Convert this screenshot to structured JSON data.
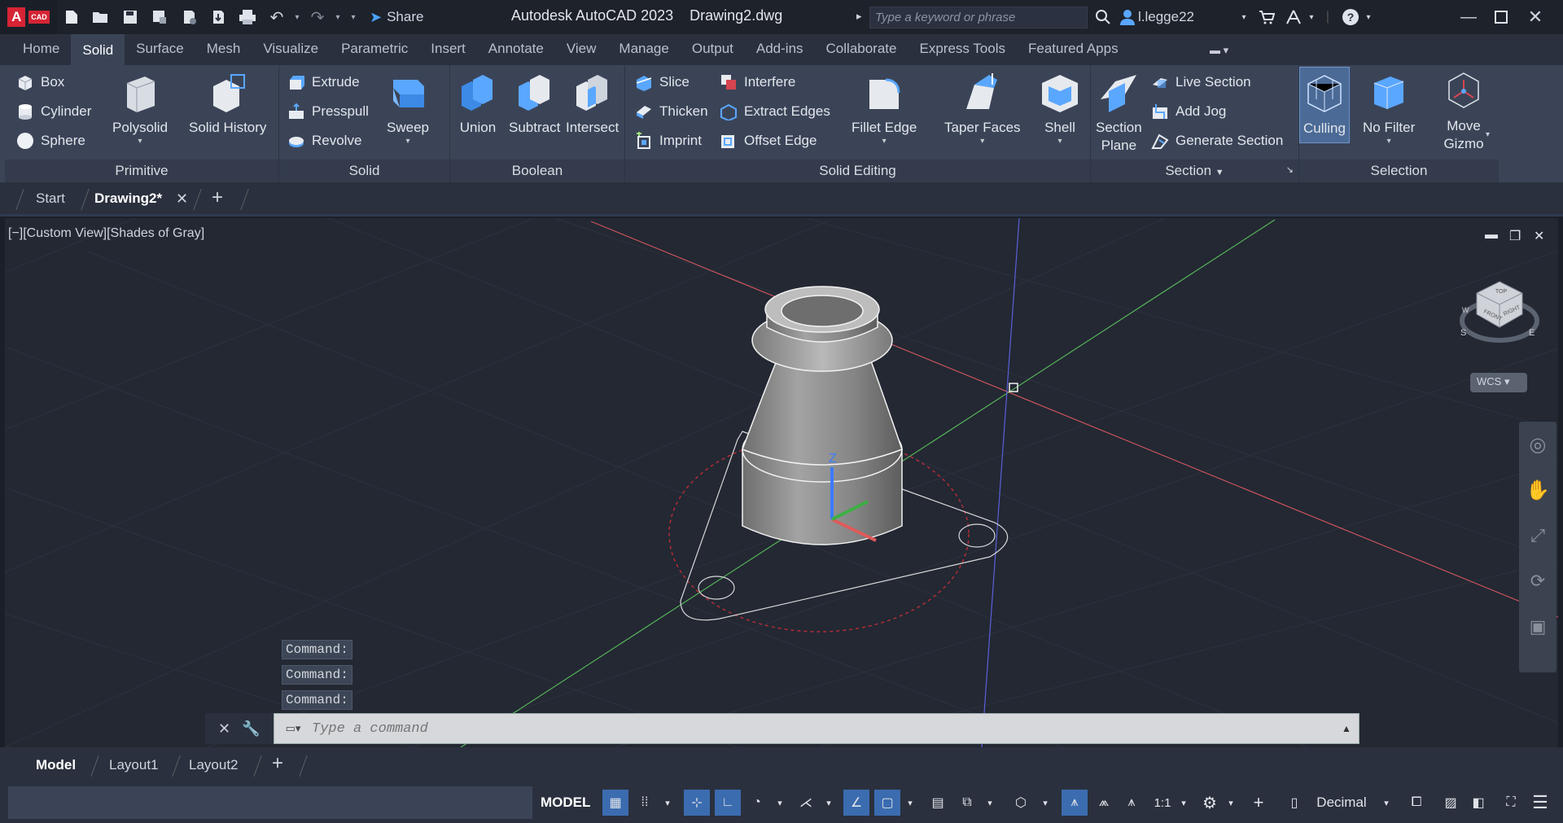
{
  "app": {
    "logo_letter": "A",
    "logo_tag": "CAD",
    "title": "Autodesk AutoCAD 2023",
    "document": "Drawing2.dwg"
  },
  "quick_access": {
    "share_label": "Share"
  },
  "search": {
    "placeholder": "Type a keyword or phrase"
  },
  "user": {
    "name": "l.legge22"
  },
  "ribbon_tabs": [
    "Home",
    "Solid",
    "Surface",
    "Mesh",
    "Visualize",
    "Parametric",
    "Insert",
    "Annotate",
    "View",
    "Manage",
    "Output",
    "Add-ins",
    "Collaborate",
    "Express Tools",
    "Featured Apps"
  ],
  "ribbon_active_tab": "Solid",
  "panels": {
    "primitive": {
      "label": "Primitive",
      "box": "Box",
      "cylinder": "Cylinder",
      "sphere": "Sphere",
      "polysolid": "Polysolid",
      "solid_history": "Solid History"
    },
    "solid": {
      "label": "Solid",
      "extrude": "Extrude",
      "presspull": "Presspull",
      "revolve": "Revolve",
      "sweep": "Sweep"
    },
    "boolean": {
      "label": "Boolean",
      "union": "Union",
      "subtract": "Subtract",
      "intersect": "Intersect"
    },
    "solid_editing": {
      "label": "Solid Editing",
      "slice": "Slice",
      "thicken": "Thicken",
      "imprint": "Imprint",
      "interfere": "Interfere",
      "extract_edges": "Extract Edges",
      "offset_edge": "Offset Edge",
      "fillet_edge": "Fillet Edge",
      "taper_faces": "Taper Faces",
      "shell": "Shell"
    },
    "section": {
      "label": "Section",
      "section_plane_1": "Section",
      "section_plane_2": "Plane",
      "live_section": "Live Section",
      "add_jog": "Add Jog",
      "generate_section": "Generate Section"
    },
    "selection": {
      "label": "Selection",
      "culling": "Culling",
      "no_filter": "No Filter",
      "move_gizmo_1": "Move",
      "move_gizmo_2": "Gizmo"
    }
  },
  "doc_tabs": {
    "start": "Start",
    "active": "Drawing2*"
  },
  "viewport": {
    "label": "[−][Custom View][Shades of Gray]",
    "wcs": "WCS",
    "viewcube_top": "TOP",
    "viewcube_front": "FRONT",
    "viewcube_right": "RIGHT",
    "compass_s": "S",
    "compass_e": "E",
    "compass_w": "W",
    "axis_z": "Z"
  },
  "command": {
    "history": [
      "Command:",
      "Command:",
      "Command:"
    ],
    "placeholder": "Type a command"
  },
  "layout_tabs": [
    "Model",
    "Layout1",
    "Layout2"
  ],
  "status": {
    "model": "MODEL",
    "scale": "1:1",
    "units": "Decimal"
  },
  "colors": {
    "accent": "#3b6cb0",
    "ribbon": "#3b4457",
    "background": "#232833",
    "x_axis": "#e05a5a",
    "y_axis": "#4caf50"
  }
}
